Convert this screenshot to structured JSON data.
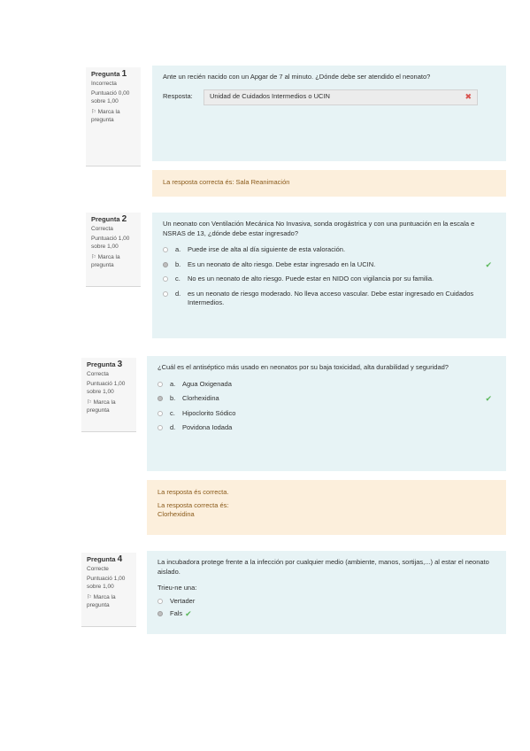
{
  "common": {
    "flag_label": "Marca la pregunta",
    "answer_label": "Resposta:",
    "choose_one": "Trieu-ne una:"
  },
  "q1": {
    "label": "Pregunta",
    "number": "1",
    "state": "Incorrecta",
    "mark": "Puntuació 0,00 sobre 1,00",
    "text": "Ante un recién nacido con un Apgar de 7 al minuto. ¿Dónde debe ser atendido el neonato?",
    "answer_value": "Unidad de Cuidados Intermedios o UCIN",
    "feedback": "La resposta correcta és: Sala Reanimación"
  },
  "q2": {
    "label": "Pregunta",
    "number": "2",
    "state": "Correcta",
    "mark": "Puntuació 1,00 sobre 1,00",
    "text": "Un neonato con Ventilación Mecánica No Invasiva, sonda orogástrica y con una puntuación en la escala e NSRAS de 13, ¿dónde debe estar ingresado?",
    "options": [
      {
        "letter": "a.",
        "text": "Puede irse de alta al día siguiente de esta valoración."
      },
      {
        "letter": "b.",
        "text": "Es un neonato de alto riesgo. Debe estar ingresado en la UCIN."
      },
      {
        "letter": "c.",
        "text": "No es un neonato de alto riesgo. Puede estar en NIDO con vigilancia por su familia."
      },
      {
        "letter": "d.",
        "text": "es un neonato de riesgo moderado. No lleva acceso vascular. Debe estar ingresado en Cuidados Intermedios."
      }
    ]
  },
  "q3": {
    "label": "Pregunta",
    "number": "3",
    "state": "Correcta",
    "mark": "Puntuació 1,00 sobre 1,00",
    "text": "¿Cuál es el antiséptico más usado en neonatos por su baja toxicidad, alta durabilidad y seguridad?",
    "options": [
      {
        "letter": "a.",
        "text": "Agua Oxigenada"
      },
      {
        "letter": "b.",
        "text": "Clorhexidina"
      },
      {
        "letter": "c.",
        "text": "Hipoclorito Sódico"
      },
      {
        "letter": "d.",
        "text": "Povidona Iodada"
      }
    ],
    "feedback_line1": "La resposta és correcta.",
    "feedback_line2": "La resposta correcta és:",
    "feedback_line3": "Clorhexidina"
  },
  "q4": {
    "label": "Pregunta",
    "number": "4",
    "state": "Correcte",
    "mark": "Puntuació 1,00 sobre 1,00",
    "text": "La incubadora protege frente a la infección por cualquier medio (ambiente, manos, sortijas,...) al estar el neonato aislado.",
    "options": [
      {
        "text": "Vertader"
      },
      {
        "text": "Fals"
      }
    ]
  },
  "colors": {
    "content_bg": "#e7f3f5",
    "feedback_bg": "#fcefdc",
    "correct": "#5cb85c",
    "incorrect": "#d9534f"
  },
  "icons": {
    "correct": "check-icon",
    "incorrect": "cross-icon",
    "flag": "flag-icon"
  }
}
